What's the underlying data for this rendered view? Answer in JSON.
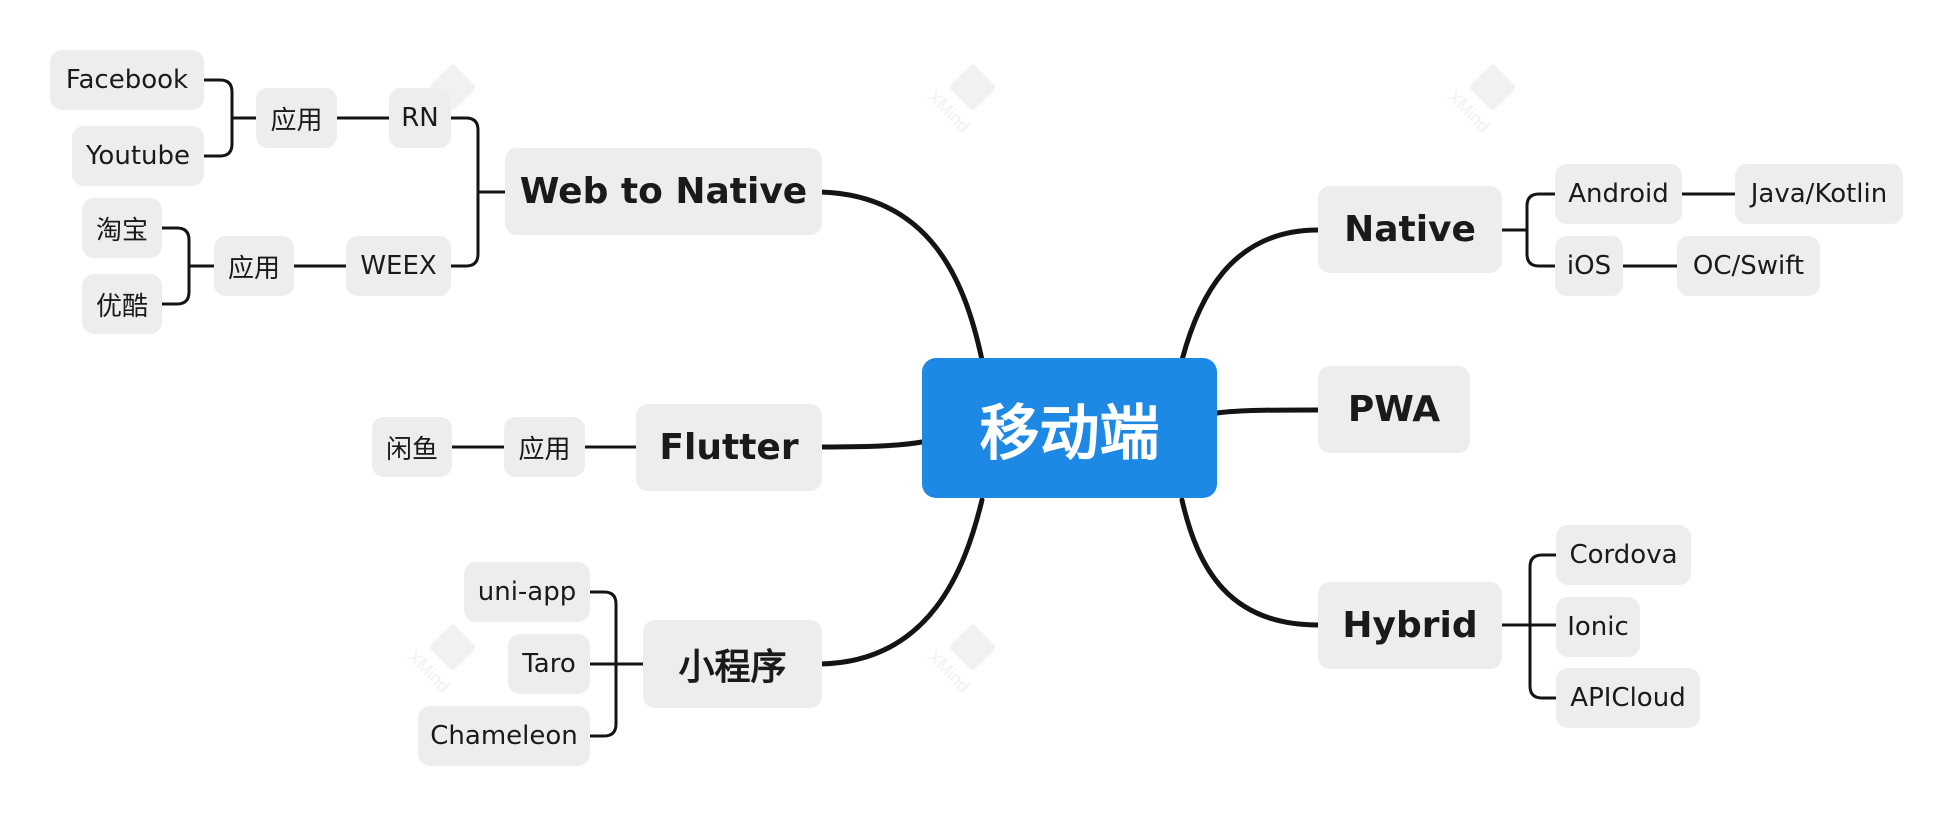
{
  "root": "移动端",
  "left": {
    "web_to_native": {
      "label": "Web to Native",
      "rn": {
        "label": "RN",
        "app_label": "应用",
        "apps": [
          "Facebook",
          "Youtube"
        ]
      },
      "weex": {
        "label": "WEEX",
        "app_label": "应用",
        "apps": [
          "淘宝",
          "优酷"
        ]
      }
    },
    "flutter": {
      "label": "Flutter",
      "app_label": "应用",
      "app": "闲鱼"
    },
    "mini_program": {
      "label": "小程序",
      "items": [
        "uni-app",
        "Taro",
        "Chameleon"
      ]
    }
  },
  "right": {
    "native": {
      "label": "Native",
      "android": {
        "label": "Android",
        "lang": "Java/Kotlin"
      },
      "ios": {
        "label": "iOS",
        "lang": "OC/Swift"
      }
    },
    "pwa": {
      "label": "PWA"
    },
    "hybrid": {
      "label": "Hybrid",
      "items": [
        "Cordova",
        "Ionic",
        "APICloud"
      ]
    }
  },
  "colors": {
    "root": "#1e88e5",
    "node": "#ededed",
    "line": "#141414"
  },
  "watermark": {
    "label": "XMind"
  }
}
